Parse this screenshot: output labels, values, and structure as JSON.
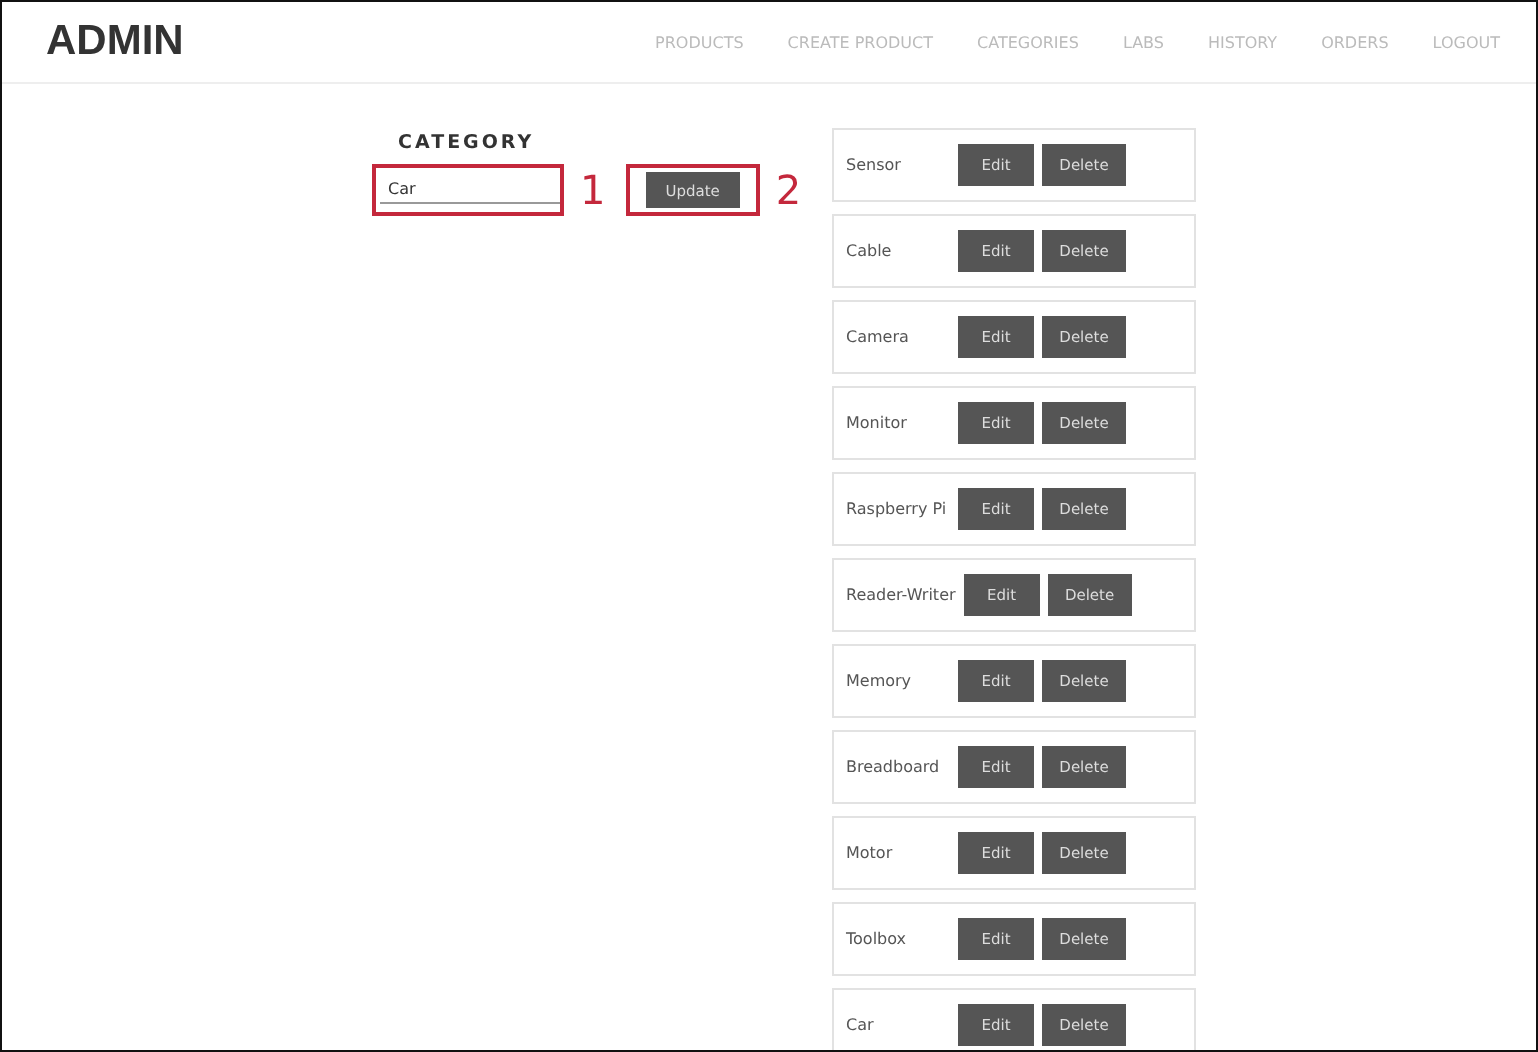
{
  "header": {
    "logo": "ADMIN",
    "nav": [
      "PRODUCTS",
      "CREATE PRODUCT",
      "CATEGORIES",
      "LABS",
      "HISTORY",
      "ORDERS",
      "LOGOUT"
    ]
  },
  "form": {
    "title": "CATEGORY",
    "value": "Car",
    "button": "Update",
    "callouts": [
      "1",
      "2"
    ]
  },
  "categories": [
    {
      "name": "Sensor",
      "edit": "Edit",
      "delete": "Delete"
    },
    {
      "name": "Cable",
      "edit": "Edit",
      "delete": "Delete"
    },
    {
      "name": "Camera",
      "edit": "Edit",
      "delete": "Delete"
    },
    {
      "name": "Monitor",
      "edit": "Edit",
      "delete": "Delete"
    },
    {
      "name": "Raspberry Pi",
      "edit": "Edit",
      "delete": "Delete"
    },
    {
      "name": "Reader-Writer",
      "edit": "Edit",
      "delete": "Delete"
    },
    {
      "name": "Memory",
      "edit": "Edit",
      "delete": "Delete"
    },
    {
      "name": "Breadboard",
      "edit": "Edit",
      "delete": "Delete"
    },
    {
      "name": "Motor",
      "edit": "Edit",
      "delete": "Delete"
    },
    {
      "name": "Toolbox",
      "edit": "Edit",
      "delete": "Delete"
    },
    {
      "name": "Car",
      "edit": "Edit",
      "delete": "Delete"
    }
  ]
}
